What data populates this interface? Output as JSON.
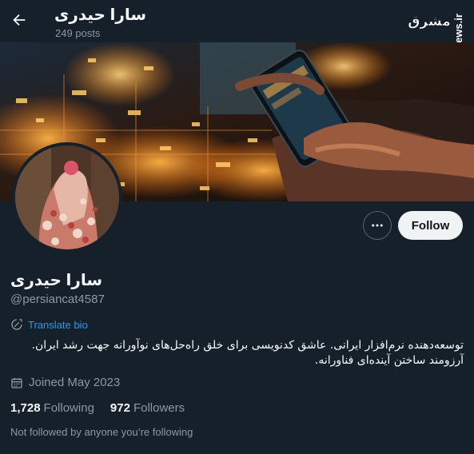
{
  "header": {
    "title": "سارا حیدری",
    "posts": "249 posts",
    "watermark_logo": "مشرق",
    "watermark_url": "mashreghnews.ir"
  },
  "profile": {
    "name": "سارا حیدری",
    "handle": "@persiancat4587",
    "follow_label": "Follow",
    "translate_label": "Translate bio",
    "bio_line1": "توسعه‌دهنده نرم‌افزار ایرانی. عاشق کدنویسی برای خلق راه‌حل‌های نوآورانه جهت رشد ایران.",
    "bio_line2": "آرزومند ساختن آینده‌ای فناورانه.",
    "joined": "Joined May 2023",
    "following_count": "1,728",
    "following_label": "Following",
    "followers_count": "972",
    "followers_label": "Followers",
    "not_followed": "Not followed by anyone you’re following"
  },
  "icons": {
    "back": "arrow-left-icon",
    "more": "more-dots-icon",
    "translate": "translate-icon",
    "calendar": "calendar-icon"
  },
  "colors": {
    "background": "#15202b",
    "accent": "#1d9bf0",
    "secondary_text": "#8b98a5",
    "follow_button": "#eff3f4"
  }
}
